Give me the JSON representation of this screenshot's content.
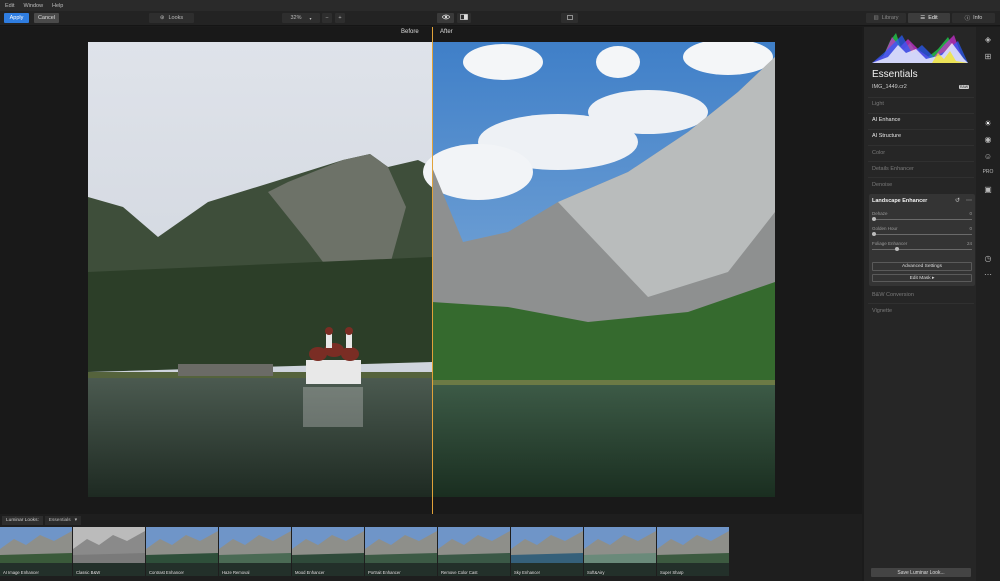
{
  "menu": [
    "Edit",
    "Window",
    "Help"
  ],
  "toolbar": {
    "apply": "Apply",
    "cancel": "Cancel",
    "looks": "Looks",
    "zoom": "32%",
    "zoom_minus": "−",
    "zoom_plus": "+",
    "tabs": {
      "library": "Library",
      "edit": "Edit",
      "info": "Info"
    }
  },
  "canvas": {
    "before_label": "Before",
    "after_label": "After"
  },
  "panel": {
    "title": "Essentials",
    "filename": "IMG_1449.cr2",
    "raw_badge": "RAW",
    "sections": [
      {
        "label": "Light",
        "state": "dim"
      },
      {
        "label": "AI Enhance",
        "state": "bright"
      },
      {
        "label": "AI Structure",
        "state": "bright"
      },
      {
        "label": "Color",
        "state": "dim"
      },
      {
        "label": "Details Enhancer",
        "state": "dim"
      },
      {
        "label": "Denoise",
        "state": "dim"
      }
    ],
    "landscape": {
      "title": "Landscape Enhancer",
      "sliders": [
        {
          "name": "Dehaze",
          "value": "0",
          "level": 0
        },
        {
          "name": "Golden Hour",
          "value": "0",
          "level": 0
        },
        {
          "name": "Foliage Enhancer",
          "value": "24",
          "level": 0.24
        }
      ],
      "advanced": "Advanced Settings",
      "edit_mask": "Edit Mask ▸"
    },
    "after_sections": [
      {
        "label": "B&W Conversion",
        "state": "dim"
      },
      {
        "label": "Vignette",
        "state": "dim"
      }
    ],
    "save_looks": "Save Luminar Look..."
  },
  "looks_bar": {
    "tab1": "Luminar Looks:",
    "tab2": "Essentials",
    "items": [
      "AI Image Enhancer",
      "Classic B&W",
      "Contrast Enhancer",
      "Haze Removal",
      "Mood Enhancer",
      "Portrait Enhancer",
      "Remove Color Cast",
      "Sky Enhancer",
      "Soft&Airy",
      "Super Sharp"
    ]
  }
}
